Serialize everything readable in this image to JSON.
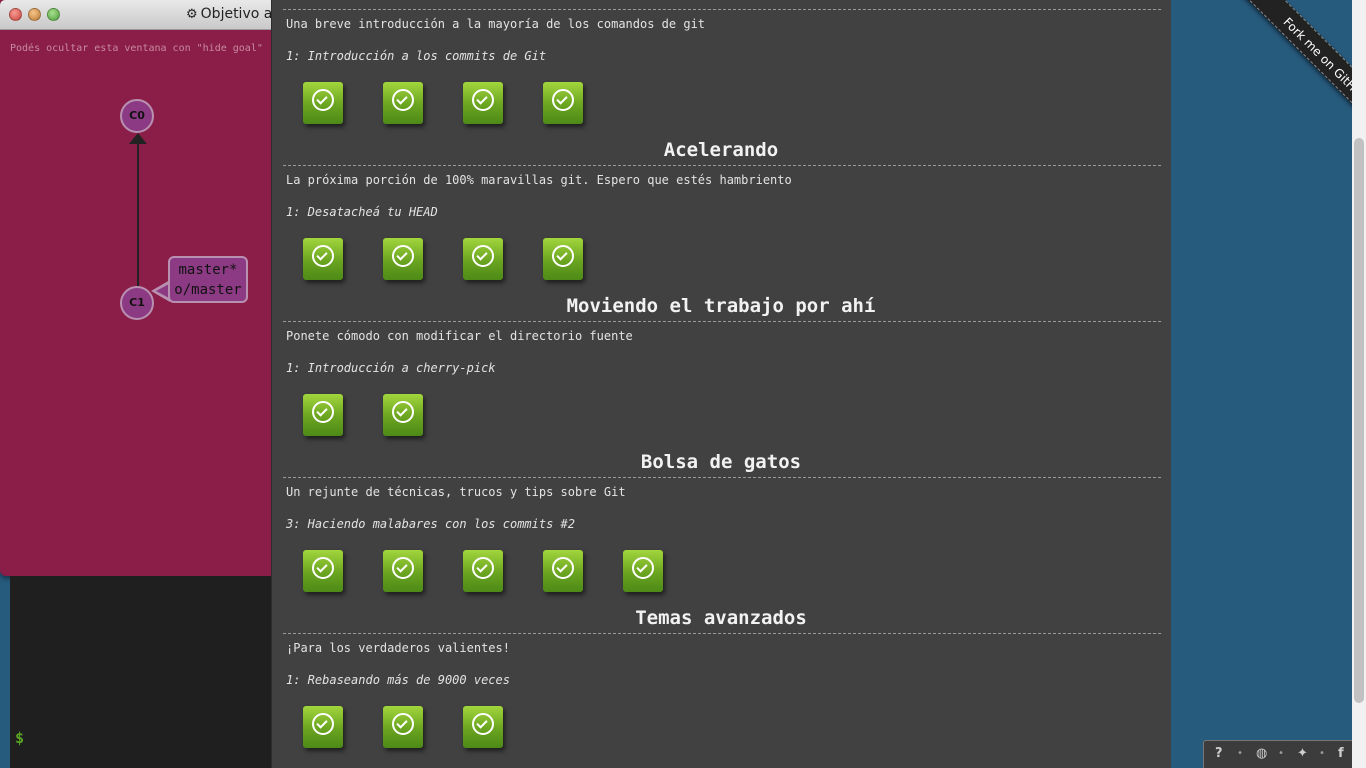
{
  "goal_window": {
    "title": "Objetivo a c",
    "hint": "Podés ocultar esta ventana con \"hide goal\"",
    "commits": [
      "C0",
      "C1"
    ],
    "branch_labels": [
      "master*",
      "o/master"
    ]
  },
  "terminal": {
    "prompt": "$"
  },
  "level_select": {
    "intro": {
      "description": "Una breve introducción a la mayoría de los comandos de git",
      "level_name": "1: Introducción a los commits de Git",
      "level_count": 4
    },
    "sequences": [
      {
        "title": "Acelerando",
        "description": "La próxima porción de 100% maravillas git. Espero que estés hambriento",
        "level_name": "1: Desatacheá tu HEAD",
        "level_count": 4
      },
      {
        "title": "Moviendo el trabajo por ahí",
        "description": "Ponete cómodo con modificar el directorio fuente",
        "level_name": "1: Introducción a cherry-pick",
        "level_count": 2
      },
      {
        "title": "Bolsa de gatos",
        "description": "Un rejunte de técnicas, trucos y tips sobre Git",
        "level_name": "3: Haciendo malabares con los commits #2",
        "level_count": 5
      },
      {
        "title": "Temas avanzados",
        "description": "¡Para los verdaderos valientes!",
        "level_name": "1: Rebaseando más de 9000 veces",
        "level_count": 3
      }
    ],
    "level_status": "solved",
    "level_icon": "check-circle-icon"
  },
  "ribbon": {
    "label": "Fork me on GitHub"
  },
  "icon_bar": {
    "icons": [
      "help-icon",
      "globe-icon",
      "twitter-icon",
      "facebook-icon"
    ],
    "glyphs": [
      "?",
      "◍",
      "✦",
      "f"
    ]
  },
  "colors": {
    "goal_background": "#8a1e48",
    "panel_background": "#414141",
    "page_background": "#275b7e",
    "solved_green": "#6aa420",
    "node_fill": "#8d3a84"
  }
}
